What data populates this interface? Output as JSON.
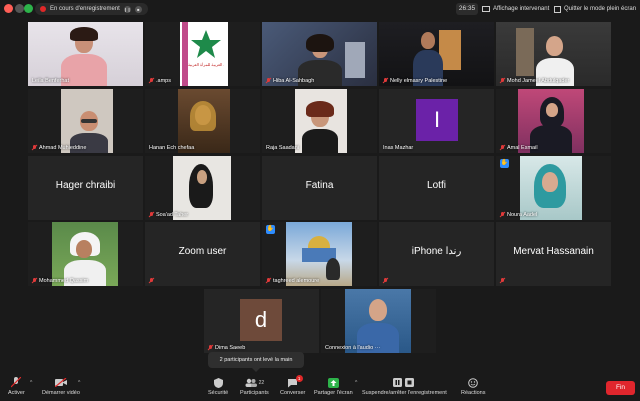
{
  "topbar": {
    "recording_label": "En cours d'enregistrement",
    "time": "26:35",
    "speaker_view_label": "Affichage intervenant",
    "exit_fullscreen_label": "Quitter le mode plein écran"
  },
  "participants": [
    {
      "name": "Leila Benferhat",
      "muted": false
    },
    {
      "name": ".amps",
      "muted": true
    },
    {
      "name": "Hiba Al-Sahbagh",
      "muted": true
    },
    {
      "name": "Nelly elmasry Palestine",
      "muted": true
    },
    {
      "name": "Mohd Jameel Abdulqader",
      "muted": true
    },
    {
      "name": "Ahmad Muhieddine",
      "muted": true
    },
    {
      "name": "Hanan Ech chefaa",
      "muted": false
    },
    {
      "name": "Raja Saadani",
      "muted": false
    },
    {
      "name": "Inas Mazhar",
      "muted": false,
      "initial": "I"
    },
    {
      "name": "Amal Esmail",
      "muted": true
    },
    {
      "name": "Hager chraibi",
      "muted": false
    },
    {
      "name": "Soa'ad Taher",
      "muted": true
    },
    {
      "name": "Fatina",
      "muted": false
    },
    {
      "name": "Lotfi",
      "muted": false
    },
    {
      "name": "Noura Aadel",
      "muted": true
    },
    {
      "name": "Mohammed Qassim",
      "muted": true
    },
    {
      "name": "Zoom user",
      "muted": true
    },
    {
      "name": "taghreed alemoure",
      "muted": true
    },
    {
      "name": "iPhone رندا",
      "muted": true
    },
    {
      "name": "Mervat Hassanain",
      "muted": true
    },
    {
      "name": "Dima Saeeb",
      "muted": true,
      "initial": "d"
    },
    {
      "name": "Connexion à l'audio ···",
      "muted": false
    }
  ],
  "logo_text": "الجمعية العربية للمرأة العربية",
  "tooltip": "2 participants ont levé la main",
  "toolbar": {
    "unmute": "Activer",
    "start_video": "Démarrer vidéo",
    "security": "Sécurité",
    "participants": "Participants",
    "participants_count": "22",
    "chat": "Converser",
    "chat_badge": "1",
    "share": "Partager l'écran",
    "recording": "Suspendre/arrêter l'enregistrement",
    "reactions": "Réactions",
    "end": "Fin"
  },
  "colors": {
    "active_speaker_border": "#e8e84b",
    "end_button": "#e0262d",
    "share_green": "#2db34a",
    "raised_hand": "#2d8cff",
    "avatar_purple": "#6b22a8",
    "avatar_brown": "#6e4a3a"
  }
}
